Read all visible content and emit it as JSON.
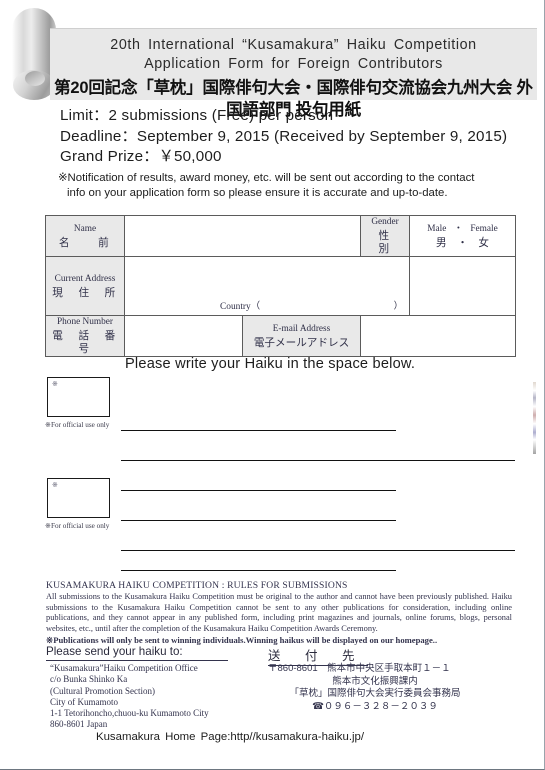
{
  "header": {
    "english_line1": "20th  International  “Kusamakura”  Haiku  Competition",
    "english_line2": "Application  Form  for  Foreign  Contributors",
    "japanese_line": "第20回記念「草枕」国際俳句大会・国際俳句交流協会九州大会 外国語部門 投句用紙"
  },
  "intro": {
    "limit": "Limit：2 submissions (Free) per person",
    "deadline": "Deadline：September 9, 2015  (Received by September 9, 2015)",
    "grand_prize": "Grand Prize：￥50,000",
    "note_line1": "※Notification of results, award money, etc. will be sent out according to the contact",
    "note_line2": "info on your application form so please ensure it is accurate and up-to-date."
  },
  "form": {
    "name_en": "Name",
    "name_jp": "名　　前",
    "gender_en": "Gender",
    "gender_jp": "性　　別",
    "gender_options_en": "Male  ・  Female",
    "gender_options_jp": "男  ・  女",
    "address_en": "Current Address",
    "address_jp": "現　住　所",
    "country_label": "Country（",
    "country_close": "）",
    "phone_en": "Phone Number",
    "phone_jp": "電　話　番　号",
    "email_en": "E-mail Address",
    "email_jp": "電子メールアドレス"
  },
  "haiku": {
    "instruction": "Please write your Haiku in the space below.",
    "official_mark": "※",
    "official_caption": "※For official use only"
  },
  "rules": {
    "heading": "KUSAMAKURA HAIKU COMPETITION : RULES FOR SUBMISSIONS",
    "body": "All submissions to the Kusamakura Haiku Competition must be original to the author and cannot have been previously published. Haiku submissions to the Kusamakura Haiku Competition cannot be sent to any other publications for consideration, including online publications, and they cannot appear in any published form, including print magazines and journals, online forums, blogs, personal websites, etc., until after the completion of the Kusamakura Haiku Competition Awards Ceremony.",
    "note": "※Publications will only be sent to winning individuals.Winning haikus will be displayed on our homepage.."
  },
  "footer": {
    "send_heading_en": "Please send your haiku to:",
    "send_heading_jp": "送　付　先",
    "address_en": [
      "“Kusamakura”Haiku Competition Office",
      "c/o Bunka Shinko Ka",
      "(Cultural Promotion Section)",
      "City of Kumamoto",
      "1-1 Tetorihoncho,chuou-ku Kumamoto City",
      "860-8601 Japan"
    ],
    "address_jp": [
      "〒860-8601　熊本市中央区手取本町１－１",
      "熊本市文化振興課内",
      "「草枕」国際俳句大会実行委員会事務局",
      "☎０９６－３２８－２０３９"
    ],
    "homepage": "Kusamakura  Home Page:http//kusamakura-haiku.jp/"
  }
}
